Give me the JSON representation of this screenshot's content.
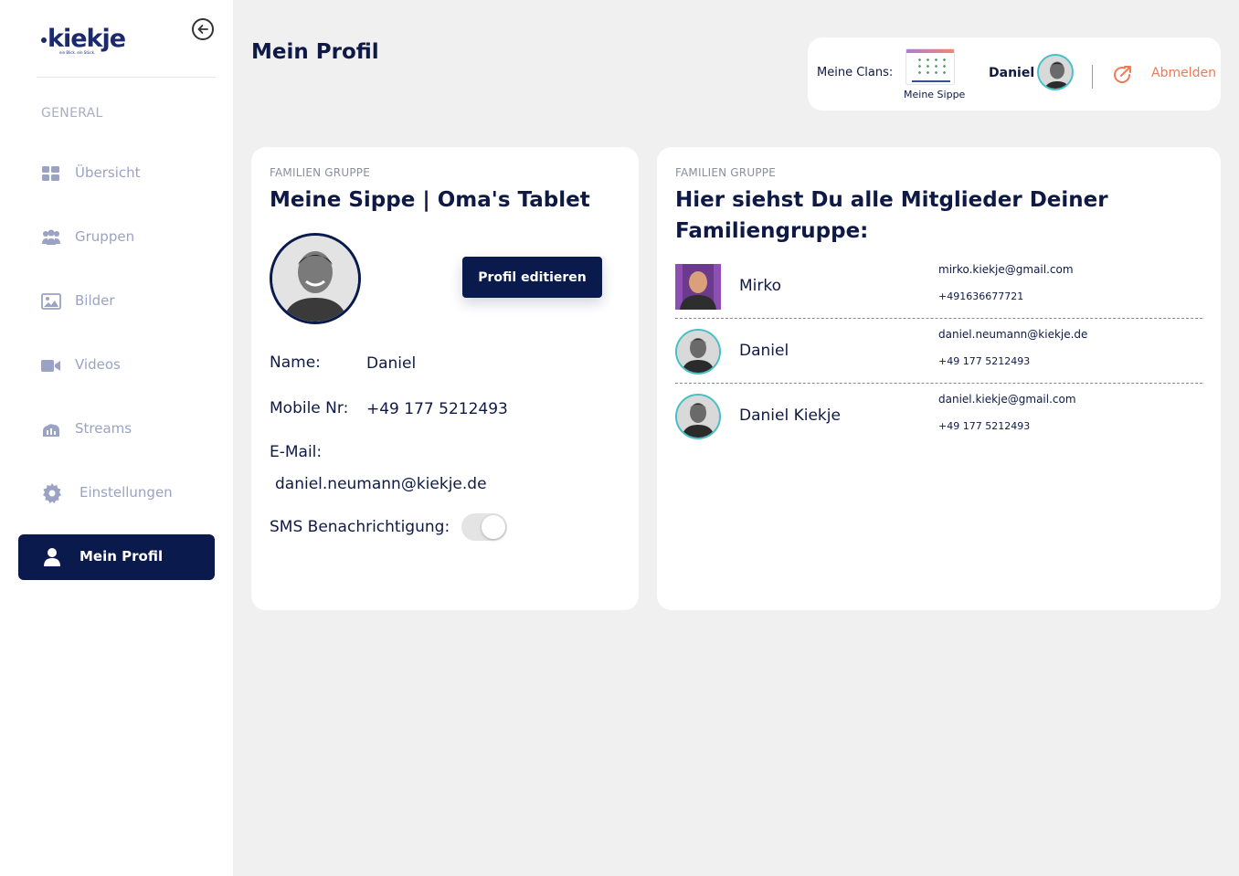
{
  "brand": {
    "logo_text": "kiekje",
    "tagline": "ein Blick. ein Stück."
  },
  "sidebar": {
    "section_label": "GENERAL",
    "items": [
      {
        "label": "Übersicht",
        "icon": "dashboard-icon"
      },
      {
        "label": "Gruppen",
        "icon": "group-icon"
      },
      {
        "label": "Bilder",
        "icon": "image-icon"
      },
      {
        "label": "Videos",
        "icon": "video-icon"
      },
      {
        "label": "Streams",
        "icon": "streams-icon"
      },
      {
        "label": "Einstellungen",
        "icon": "gear-icon"
      },
      {
        "label": "Mein Profil",
        "icon": "user-icon",
        "active": true
      }
    ]
  },
  "header": {
    "page_title": "Mein Profil",
    "clans_label": "Meine Clans:",
    "clan_name": "Meine Sippe",
    "user_name": "Daniel",
    "logout_label": "Abmelden"
  },
  "profile_card": {
    "eyebrow": "FAMILIEN GRUPPE",
    "title": "Meine Sippe | Oma's Tablet",
    "edit_button": "Profil editieren",
    "name_label": "Name:",
    "name_value": "Daniel",
    "mobile_label": "Mobile Nr:",
    "mobile_value": "+49 177 5212493",
    "email_label": "E-Mail:",
    "email_value": "daniel.neumann@kiekje.de",
    "sms_label": "SMS Benachrichtigung:",
    "sms_enabled": false
  },
  "members_card": {
    "eyebrow": "FAMILIEN GRUPPE",
    "title": "Hier siehst Du alle Mitglieder Deiner Familiengruppe:",
    "members": [
      {
        "name": "Mirko",
        "email": "mirko.kiekje@gmail.com",
        "phone": "+491636677721"
      },
      {
        "name": "Daniel",
        "email": "daniel.neumann@kiekje.de",
        "phone": "+49 177 5212493"
      },
      {
        "name": "Daniel Kiekje",
        "email": "daniel.kiekje@gmail.com",
        "phone": "+49 177 5212493"
      }
    ]
  },
  "colors": {
    "primary": "#0b1a4d",
    "accent_teal": "#45c1c6",
    "accent_orange": "#f07a55",
    "nav_muted": "#9aa3c4",
    "background": "#f0f0f0"
  }
}
